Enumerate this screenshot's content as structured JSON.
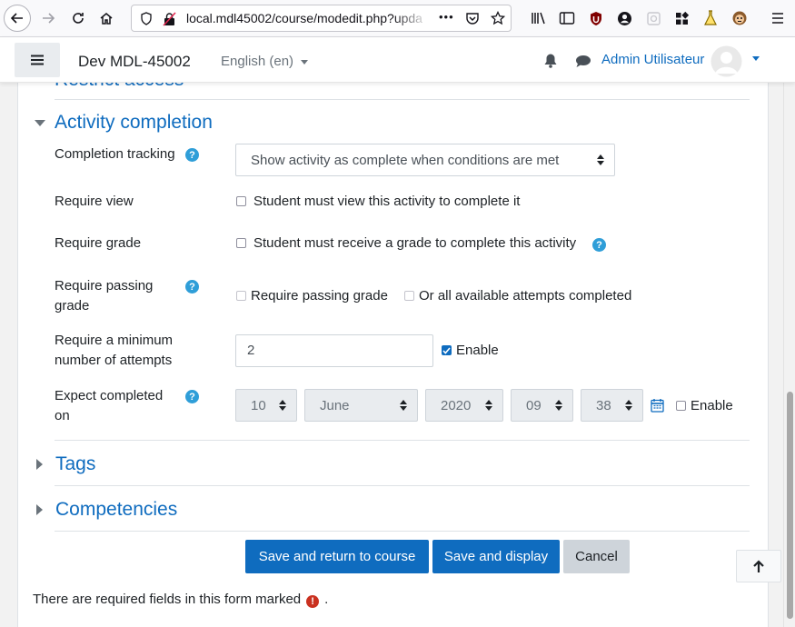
{
  "browser": {
    "url": "local.mdl45002/course/modedit.php?upda",
    "overflow_menu": "•••"
  },
  "navbar": {
    "site_name": "Dev MDL-45002",
    "language": "English (en)",
    "user_name": "Admin Utilisateur"
  },
  "form": {
    "prev_section_partial": "Restrict access",
    "activity_completion": {
      "heading": "Activity completion",
      "completion_tracking": {
        "label": "Completion tracking",
        "value": "Show activity as complete when conditions are met"
      },
      "require_view": {
        "label": "Require view",
        "checkbox_label": "Student must view this activity to complete it",
        "checked": false
      },
      "require_grade": {
        "label": "Require grade",
        "checkbox_label": "Student must receive a grade to complete this activity",
        "checked": false
      },
      "require_passing_grade": {
        "label_line1": "Require passing",
        "label_line2": "grade",
        "option1": "Require passing grade",
        "option2": "Or all available attempts completed"
      },
      "min_attempts": {
        "label_line1": "Require a minimum",
        "label_line2": "number of attempts",
        "value": "2",
        "enable_label": "Enable",
        "enabled": true
      },
      "expect_completed": {
        "label_line1": "Expect completed",
        "label_line2": "on",
        "day": "10",
        "month": "June",
        "year": "2020",
        "hour": "09",
        "minute": "38",
        "enable_label": "Enable",
        "enabled": false
      }
    },
    "tags_heading": "Tags",
    "competencies_heading": "Competencies",
    "buttons": {
      "save_return": "Save and return to course",
      "save_display": "Save and display",
      "cancel": "Cancel"
    },
    "required_note_before": "There are required fields in this form marked",
    "required_note_after": "."
  },
  "colors": {
    "primary": "#0f6cbf",
    "help": "#2f9ed8",
    "required": "#ca3120"
  }
}
